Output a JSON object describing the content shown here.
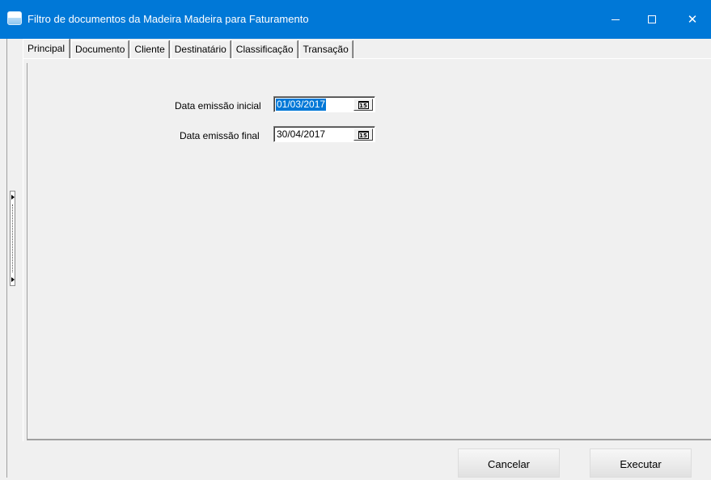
{
  "window": {
    "title": "Filtro de documentos da Madeira Madeira para Faturamento",
    "accent_color": "#0078d7",
    "icon": "window-app-icon",
    "controls": {
      "minimize_icon": "minimize-icon",
      "maximize_icon": "maximize-icon",
      "close_glyph": "✕"
    }
  },
  "tabs": [
    {
      "label": "Principal",
      "active": true
    },
    {
      "label": "Documento",
      "active": false
    },
    {
      "label": "Cliente",
      "active": false
    },
    {
      "label": "Destinatário",
      "active": false
    },
    {
      "label": "Classificação",
      "active": false
    },
    {
      "label": "Transação",
      "active": false
    }
  ],
  "principal": {
    "data_emissao_inicial": {
      "label": "Data emissão inicial",
      "value": "01/03/2017",
      "selected": true,
      "calendar_icon": "15"
    },
    "data_emissao_final": {
      "label": "Data emissão final",
      "value": "30/04/2017",
      "selected": false,
      "calendar_icon": "15"
    }
  },
  "footer": {
    "cancel_label": "Cancelar",
    "execute_label": "Executar"
  }
}
